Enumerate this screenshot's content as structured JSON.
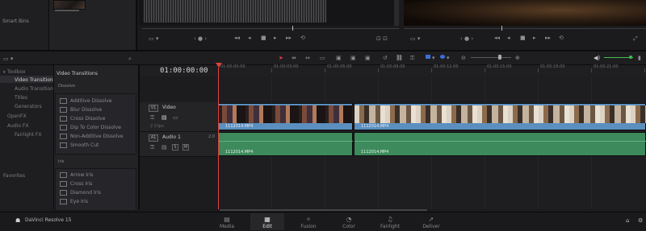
{
  "app": {
    "name": "DaVinci Resolve 15"
  },
  "media_pool": {
    "smart_bins_label": "Smart Bins"
  },
  "viewer": {
    "source_transport": [
      "◂◂",
      "◂",
      "■",
      "▸",
      "▸▸",
      "⟲"
    ],
    "program_transport": [
      "◂◂",
      "◂",
      "■",
      "▸",
      "▸▸",
      "⟲"
    ]
  },
  "effects_library": {
    "sidebar": {
      "items": [
        "Toolbox",
        "Video Transitions",
        "Audio Transitions",
        "Titles",
        "Generators",
        "OpenFX",
        "Audio FX",
        "Fairlight FX",
        "Favorites"
      ]
    },
    "panel_title": "Video Transitions",
    "dissolve_label": "Dissolve",
    "dissolve_items": [
      "Additive Dissolve",
      "Blur Dissolve",
      "Cross Dissolve",
      "Dip To Color Dissolve",
      "Non-Additive Dissolve",
      "Smooth Cut"
    ],
    "iris_label": "Iris",
    "iris_items": [
      "Arrow Iris",
      "Cross Iris",
      "Diamond Iris",
      "Eye Iris"
    ]
  },
  "timeline": {
    "timecode": "01:00:00:00",
    "ruler_labels": [
      "01:00:00:00",
      "01:00:03:00",
      "01:00:06:00",
      "01:00:09:00",
      "01:00:12:00",
      "01:00:15:00",
      "01:00:18:00",
      "01:00:21:00",
      "01:00:24:00"
    ],
    "video_track": {
      "id": "V1",
      "name": "Video",
      "clip_count": "2 Clips"
    },
    "audio_track": {
      "id": "A1",
      "name": "Audio 1",
      "level": "2.0"
    },
    "clips": [
      {
        "video_name": "1112014.MP4",
        "audio_name": "1112014.MP4"
      },
      {
        "video_name": "1112014.MP4",
        "audio_name": "1112014.MP4"
      }
    ]
  },
  "pages": [
    {
      "label": "Media",
      "icon": "▤"
    },
    {
      "label": "Edit",
      "icon": "▦"
    },
    {
      "label": "Fusion",
      "icon": "✧"
    },
    {
      "label": "Color",
      "icon": "◔"
    },
    {
      "label": "Fairlight",
      "icon": "♫"
    },
    {
      "label": "Deliver",
      "icon": "➚"
    }
  ],
  "active_page": "Edit",
  "colors": {
    "video_track": "#5b8fbf",
    "audio_track": "#3d8a5c",
    "playhead": "#e2413a",
    "slider": "#3fbf4d",
    "flag_blue": "#3d6fd6"
  }
}
